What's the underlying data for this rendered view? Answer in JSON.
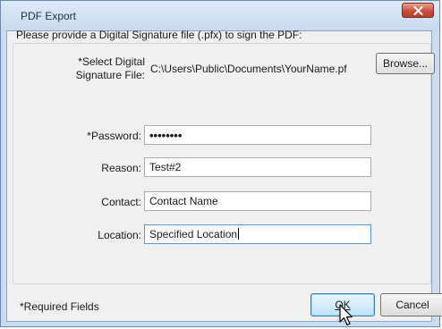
{
  "window": {
    "title": "PDF Export"
  },
  "form": {
    "instruction": "Please provide a Digital Signature file (.pfx) to sign the PDF:",
    "signature_label_line1": "*Select Digital",
    "signature_label_line2": "Signature File:",
    "signature_path": "C:\\Users\\Public\\Documents\\YourName.pf",
    "browse_label": "Browse...",
    "password_label": "*Password:",
    "password_value": "••••••••",
    "reason_label": "Reason:",
    "reason_value": "Test#2",
    "contact_label": "Contact:",
    "contact_value": "Contact Name",
    "location_label": "Location:",
    "location_value": "Specified Location"
  },
  "footer": {
    "required_note": "*Required Fields",
    "ok_label": "OK",
    "cancel_label": "Cancel"
  },
  "icons": {
    "close": "close-icon",
    "cursor": "mouse-pointer-icon"
  }
}
